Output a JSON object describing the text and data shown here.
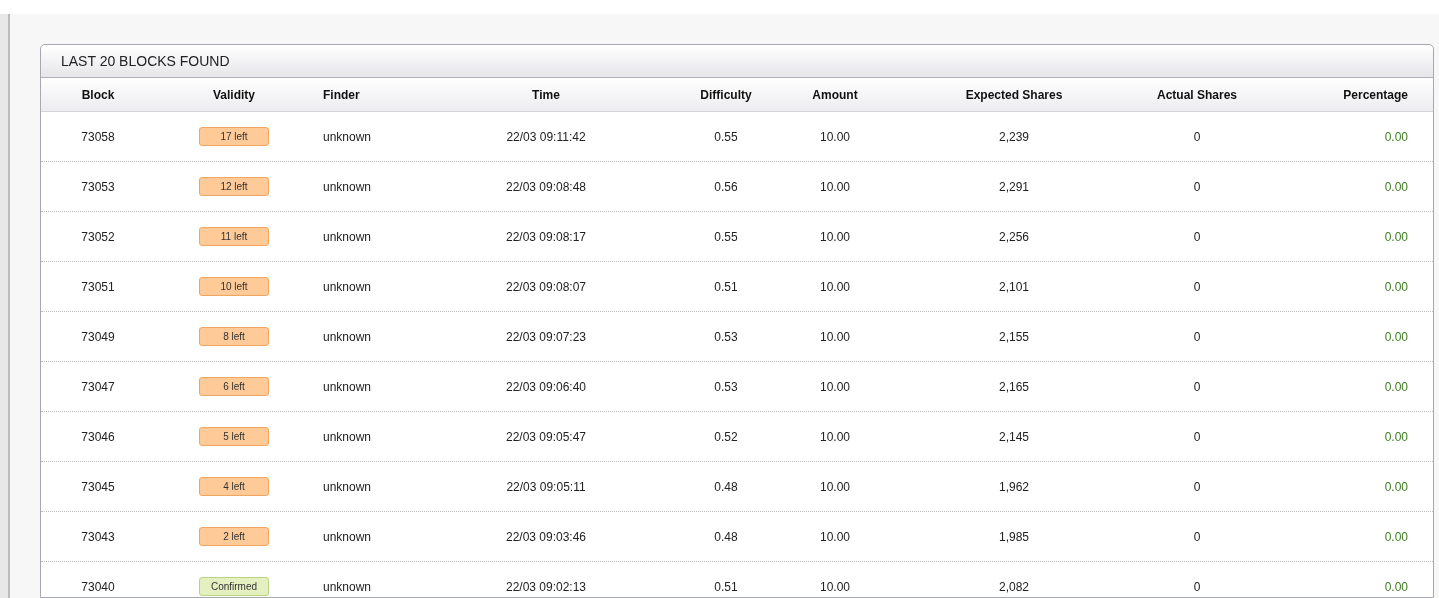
{
  "panel": {
    "title": "LAST 20 BLOCKS FOUND",
    "columns": [
      "Block",
      "Validity",
      "Finder",
      "Time",
      "Difficulty",
      "Amount",
      "Expected Shares",
      "Actual Shares",
      "Percentage"
    ],
    "rows": [
      {
        "block": "73058",
        "validity": {
          "kind": "pending",
          "label": "17 left"
        },
        "finder": "unknown",
        "time": "22/03 09:11:42",
        "difficulty": "0.55",
        "amount": "10.00",
        "expected": "2,239",
        "actual": "0",
        "percentage": "0.00"
      },
      {
        "block": "73053",
        "validity": {
          "kind": "pending",
          "label": "12 left"
        },
        "finder": "unknown",
        "time": "22/03 09:08:48",
        "difficulty": "0.56",
        "amount": "10.00",
        "expected": "2,291",
        "actual": "0",
        "percentage": "0.00"
      },
      {
        "block": "73052",
        "validity": {
          "kind": "pending",
          "label": "11 left"
        },
        "finder": "unknown",
        "time": "22/03 09:08:17",
        "difficulty": "0.55",
        "amount": "10.00",
        "expected": "2,256",
        "actual": "0",
        "percentage": "0.00"
      },
      {
        "block": "73051",
        "validity": {
          "kind": "pending",
          "label": "10 left"
        },
        "finder": "unknown",
        "time": "22/03 09:08:07",
        "difficulty": "0.51",
        "amount": "10.00",
        "expected": "2,101",
        "actual": "0",
        "percentage": "0.00"
      },
      {
        "block": "73049",
        "validity": {
          "kind": "pending",
          "label": "8 left"
        },
        "finder": "unknown",
        "time": "22/03 09:07:23",
        "difficulty": "0.53",
        "amount": "10.00",
        "expected": "2,155",
        "actual": "0",
        "percentage": "0.00"
      },
      {
        "block": "73047",
        "validity": {
          "kind": "pending",
          "label": "6 left"
        },
        "finder": "unknown",
        "time": "22/03 09:06:40",
        "difficulty": "0.53",
        "amount": "10.00",
        "expected": "2,165",
        "actual": "0",
        "percentage": "0.00"
      },
      {
        "block": "73046",
        "validity": {
          "kind": "pending",
          "label": "5 left"
        },
        "finder": "unknown",
        "time": "22/03 09:05:47",
        "difficulty": "0.52",
        "amount": "10.00",
        "expected": "2,145",
        "actual": "0",
        "percentage": "0.00"
      },
      {
        "block": "73045",
        "validity": {
          "kind": "pending",
          "label": "4 left"
        },
        "finder": "unknown",
        "time": "22/03 09:05:11",
        "difficulty": "0.48",
        "amount": "10.00",
        "expected": "1,962",
        "actual": "0",
        "percentage": "0.00"
      },
      {
        "block": "73043",
        "validity": {
          "kind": "pending",
          "label": "2 left"
        },
        "finder": "unknown",
        "time": "22/03 09:03:46",
        "difficulty": "0.48",
        "amount": "10.00",
        "expected": "1,985",
        "actual": "0",
        "percentage": "0.00"
      },
      {
        "block": "73040",
        "validity": {
          "kind": "confirmed",
          "label": "Confirmed"
        },
        "finder": "unknown",
        "time": "22/03 09:02:13",
        "difficulty": "0.51",
        "amount": "10.00",
        "expected": "2,082",
        "actual": "0",
        "percentage": "0.00"
      }
    ]
  }
}
